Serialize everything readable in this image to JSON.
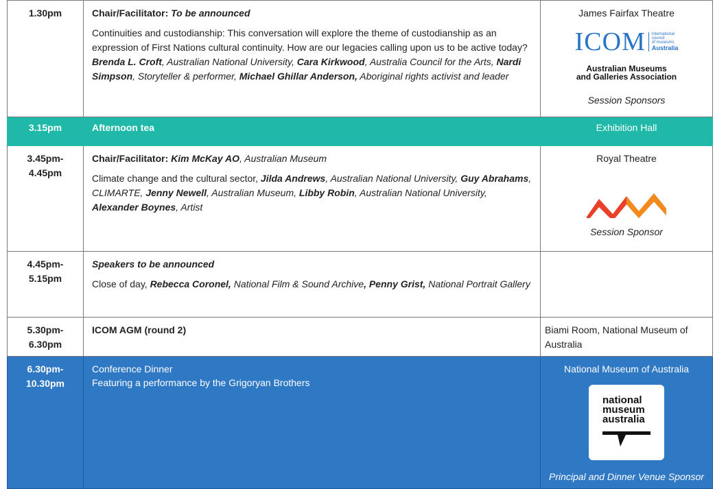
{
  "rows": [
    {
      "time": [
        "1.30pm"
      ],
      "chair_label": "Chair/Facilitator:",
      "chair_name": "To be announced",
      "description": {
        "intro": "Continuities and custodianship: This conversation will explore the theme of custodianship as an expression of First Nations cultural continuity. How are our legacies calling upon us to be active today?",
        "speakers": [
          {
            "name": "Brenda L. Croft",
            "affiliation": ", Australian National University, "
          },
          {
            "name": "Cara Kirkwood",
            "affiliation": ", Australia Council for the Arts, "
          },
          {
            "name": "Nardi Simpson",
            "affiliation": ", Storyteller & performer, "
          },
          {
            "name": "Michael Ghillar Anderson,",
            "affiliation": " Aboriginal rights activist and leader"
          }
        ]
      },
      "venue": "James Fairfax Theatre",
      "logo": {
        "icom_letters": "ICOM",
        "icom_small": [
          "International",
          "council",
          "of museums"
        ],
        "icom_country": "Australia",
        "amaga": [
          "Australian Museums",
          "and Galleries Association"
        ]
      },
      "sponsor_caption": "Session Sponsors"
    },
    {
      "time": [
        "3.15pm"
      ],
      "title": "Afternoon tea",
      "venue": "Exhibition Hall"
    },
    {
      "time": [
        "3.45pm-",
        "4.45pm"
      ],
      "chair_label": "Chair/Facilitator:",
      "chair_name": "Kim McKay AO",
      "chair_affiliation": ", Australian Museum",
      "description": {
        "intro": "Climate change and the cultural sector,",
        "speakers": [
          {
            "name": "Jilda Andrews",
            "affiliation": ", Australian National University, "
          },
          {
            "name": "Guy Abrahams",
            "affiliation": ", CLIMARTE, "
          },
          {
            "name": "Jenny Newell",
            "affiliation": ", Australian Museum, "
          },
          {
            "name": "Libby Robin",
            "affiliation": ", Australian National University, "
          },
          {
            "name": "Alexander Boynes",
            "affiliation": ", Artist"
          }
        ]
      },
      "venue": "Royal Theatre",
      "sponsor_caption": "Session Sponsor"
    },
    {
      "time": [
        "4.45pm-",
        "5.15pm"
      ],
      "title": "Speakers to be announced",
      "description": {
        "intro": "Close of day,",
        "speakers": [
          {
            "name": "Rebecca Coronel,",
            "affiliation": " National Film & Sound Archive"
          },
          {
            "name": ", Penny Grist,",
            "affiliation": " National Portrait Gallery"
          }
        ]
      },
      "venue": ""
    },
    {
      "time": [
        "5.30pm-",
        "6.30pm"
      ],
      "title": "ICOM AGM (round 2)",
      "venue": "Biami Room, National Museum of Australia"
    },
    {
      "time": [
        "6.30pm-",
        "10.30pm"
      ],
      "lines": [
        "Conference Dinner",
        "Featuring a performance by the Grigoryan Brothers"
      ],
      "venue": "National Museum of Australia",
      "logo": {
        "nma": [
          "national",
          "museum",
          "australia"
        ]
      },
      "sponsor_caption": "Principal and Dinner Venue Sponsor"
    }
  ],
  "colors": {
    "tea_bg": "#20b8a8",
    "dinner_bg": "#2f78c4",
    "wave_logo": [
      "#e8402a",
      "#f28a1e"
    ]
  }
}
